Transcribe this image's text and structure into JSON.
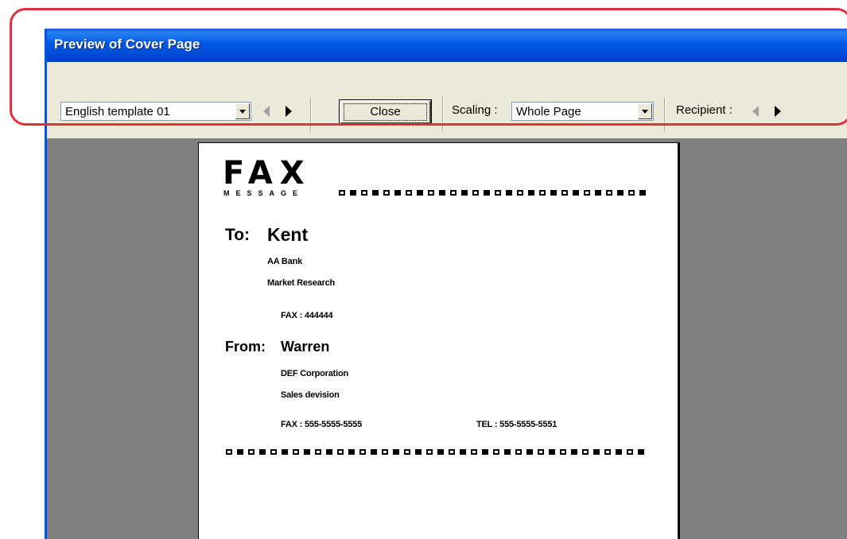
{
  "window": {
    "title": "Preview of Cover Page"
  },
  "toolbar": {
    "template": {
      "value": "English template 01"
    },
    "close_label": "Close",
    "scaling": {
      "label": "Scaling :",
      "value": "Whole Page"
    },
    "recipient": {
      "label": "Recipient :"
    }
  },
  "page": {
    "fax_title": "FAX",
    "fax_subtitle": "MESSAGE",
    "to": {
      "label": "To:",
      "name": "Kent",
      "company": "AA Bank",
      "department": "Market Research",
      "fax": "FAX : 444444"
    },
    "from": {
      "label": "From:",
      "name": "Warren",
      "company": "DEF Corporation",
      "department": "Sales devision",
      "fax": "FAX : 555-5555-5555",
      "tel": "TEL : 555-5555-5551"
    }
  },
  "colors": {
    "titlebar": "#0058e6",
    "preview_background": "#808080",
    "highlight_frame": "#e0303c"
  }
}
